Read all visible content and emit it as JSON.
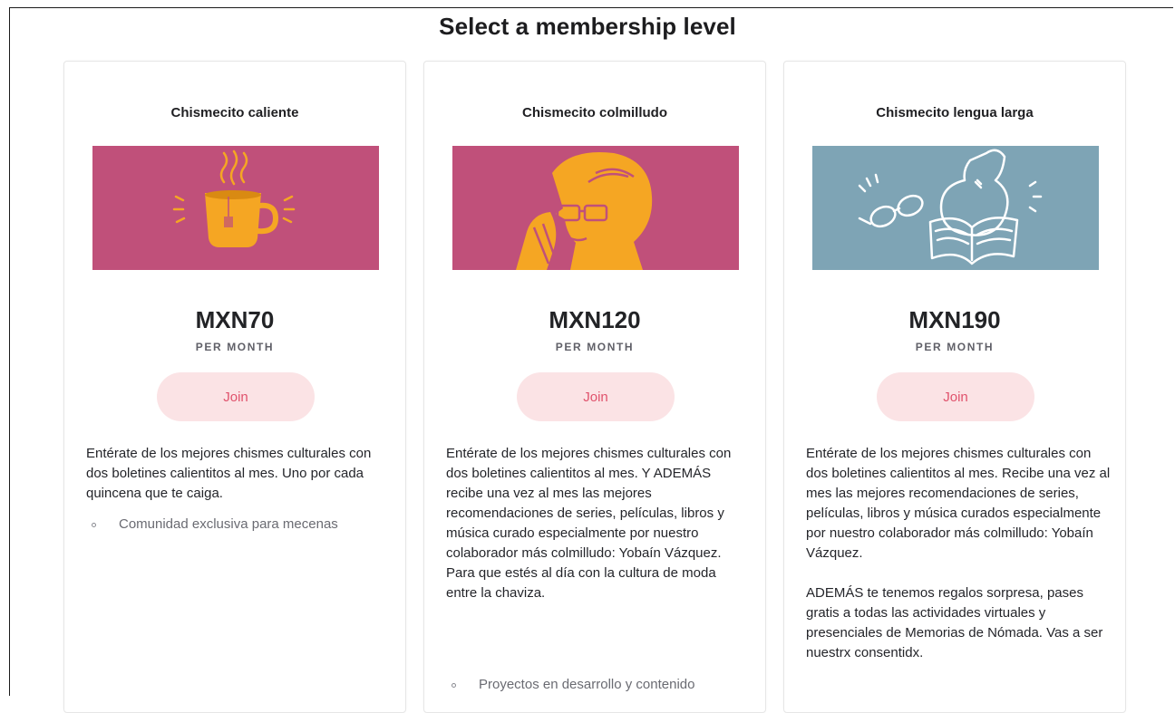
{
  "page": {
    "title": "Select a membership level"
  },
  "colors": {
    "pink_banner": "#c0507a",
    "blue_banner": "#7ea4b5",
    "illustration_orange": "#f5a623",
    "join_bg": "#fbe3e5",
    "join_text": "#e0526c"
  },
  "tiers": [
    {
      "name": "Chismecito caliente",
      "image_icon": "coffee-cup-illustration",
      "price": "MXN70",
      "period": "PER MONTH",
      "button_label": "Join",
      "description": [
        "Entérate de los mejores chismes culturales con dos boletines calientitos al mes. Uno por cada quincena que te caiga."
      ],
      "benefits": [
        "Comunidad exclusiva para mecenas"
      ]
    },
    {
      "name": "Chismecito colmilludo",
      "image_icon": "whispering-person-illustration",
      "price": "MXN120",
      "period": "PER MONTH",
      "button_label": "Join",
      "description": [
        "Entérate de los mejores chismes culturales con dos boletines calientitos al mes. Y ADEMÁS recibe una vez al mes las mejores recomendaciones de series, películas, libros y música curado especialmente por nuestro colaborador más colmilludo: Yobaín Vázquez. Para que estés al día con la cultura de moda entre la chaviza."
      ],
      "benefits": [
        "Proyectos en desarrollo y contenido"
      ]
    },
    {
      "name": "Chismecito lengua larga",
      "image_icon": "glasses-book-illustration",
      "price": "MXN190",
      "period": "PER MONTH",
      "button_label": "Join",
      "description": [
        "Entérate de los mejores chismes culturales con dos boletines calientitos al mes. Recibe una vez al mes las mejores recomendaciones de series, películas, libros y música curados especialmente por nuestro colaborador más colmilludo: Yobaín Vázquez.",
        "ADEMÁS te tenemos regalos sorpresa, pases gratis a todas las actividades virtuales y presenciales de Memorias de Nómada. Vas a ser nuestrx consentidx."
      ],
      "benefits": []
    }
  ]
}
